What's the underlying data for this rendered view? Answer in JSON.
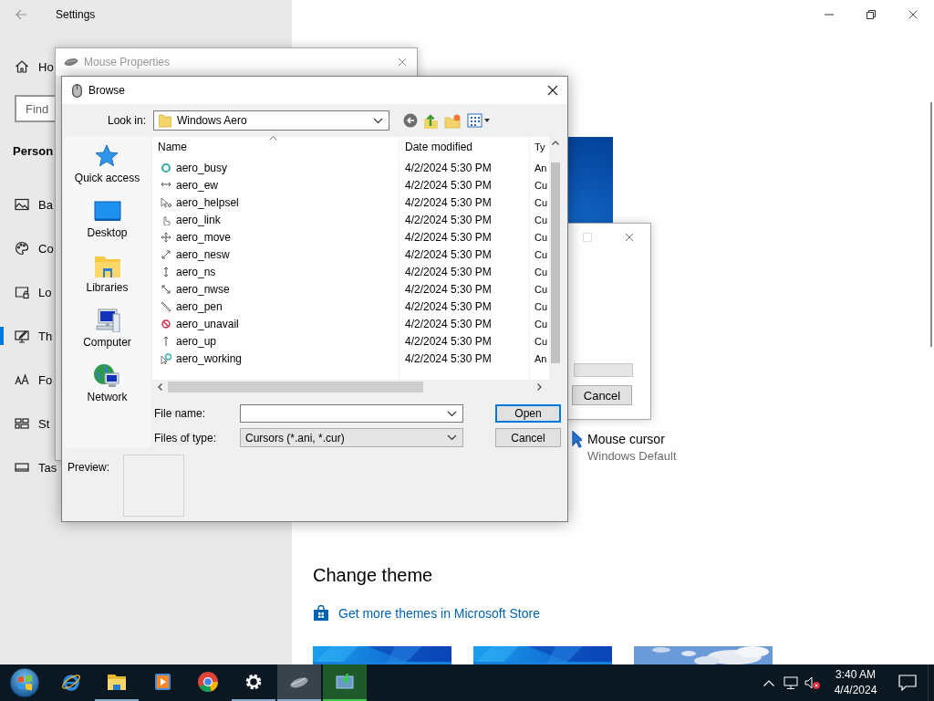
{
  "settings": {
    "title": "Settings",
    "home": "Ho",
    "search": {
      "placeholder": "Find"
    },
    "section": "Person",
    "nav": [
      {
        "label": "Ba",
        "selected": false
      },
      {
        "label": "Co",
        "selected": false
      },
      {
        "label": "Lo",
        "selected": false
      },
      {
        "label": "Th",
        "selected": true
      },
      {
        "label": "Fo",
        "selected": false
      },
      {
        "label": "St",
        "selected": false
      },
      {
        "label": "Tas",
        "selected": false
      }
    ],
    "mouse_cursor": {
      "title": "Mouse cursor",
      "value": "Windows Default"
    },
    "change_theme": {
      "heading": "Change theme",
      "store_link": "Get more themes in Microsoft Store"
    }
  },
  "mouse_properties": {
    "title": "Mouse Properties"
  },
  "pointer_dialog": {
    "button": "Cancel"
  },
  "browse": {
    "title": "Browse",
    "look_in_label": "Look in:",
    "look_in": "Windows Aero",
    "places": [
      "Quick access",
      "Desktop",
      "Libraries",
      "Computer",
      "Network"
    ],
    "columns": [
      "Name",
      "Date modified",
      "Ty"
    ],
    "files": [
      {
        "name": "aero_busy",
        "date": "4/2/2024 5:30 PM",
        "type": "An"
      },
      {
        "name": "aero_ew",
        "date": "4/2/2024 5:30 PM",
        "type": "Cu"
      },
      {
        "name": "aero_helpsel",
        "date": "4/2/2024 5:30 PM",
        "type": "Cu"
      },
      {
        "name": "aero_link",
        "date": "4/2/2024 5:30 PM",
        "type": "Cu"
      },
      {
        "name": "aero_move",
        "date": "4/2/2024 5:30 PM",
        "type": "Cu"
      },
      {
        "name": "aero_nesw",
        "date": "4/2/2024 5:30 PM",
        "type": "Cu"
      },
      {
        "name": "aero_ns",
        "date": "4/2/2024 5:30 PM",
        "type": "Cu"
      },
      {
        "name": "aero_nwse",
        "date": "4/2/2024 5:30 PM",
        "type": "Cu"
      },
      {
        "name": "aero_pen",
        "date": "4/2/2024 5:30 PM",
        "type": "Cu"
      },
      {
        "name": "aero_unavail",
        "date": "4/2/2024 5:30 PM",
        "type": "Cu"
      },
      {
        "name": "aero_up",
        "date": "4/2/2024 5:30 PM",
        "type": "Cu"
      },
      {
        "name": "aero_working",
        "date": "4/2/2024 5:30 PM",
        "type": "An"
      }
    ],
    "file_name_label": "File name:",
    "files_of_type_label": "Files of type:",
    "files_of_type": "Cursors (*.ani, *.cur)",
    "buttons": [
      {
        "label": "Open",
        "default": true
      },
      {
        "label": "Cancel",
        "default": false
      }
    ],
    "preview_label": "Preview:"
  },
  "taskbar": {
    "apps": [
      {
        "open": false,
        "active": false,
        "flashing": false
      },
      {
        "open": true,
        "active": false,
        "flashing": false
      },
      {
        "open": false,
        "active": false,
        "flashing": false
      },
      {
        "open": false,
        "active": false,
        "flashing": false
      },
      {
        "open": true,
        "active": false,
        "flashing": false
      },
      {
        "open": true,
        "active": true,
        "flashing": false
      },
      {
        "open": true,
        "active": false,
        "flashing": true
      }
    ],
    "clock": {
      "time": "3:40 AM",
      "date": "4/4/2024"
    }
  }
}
